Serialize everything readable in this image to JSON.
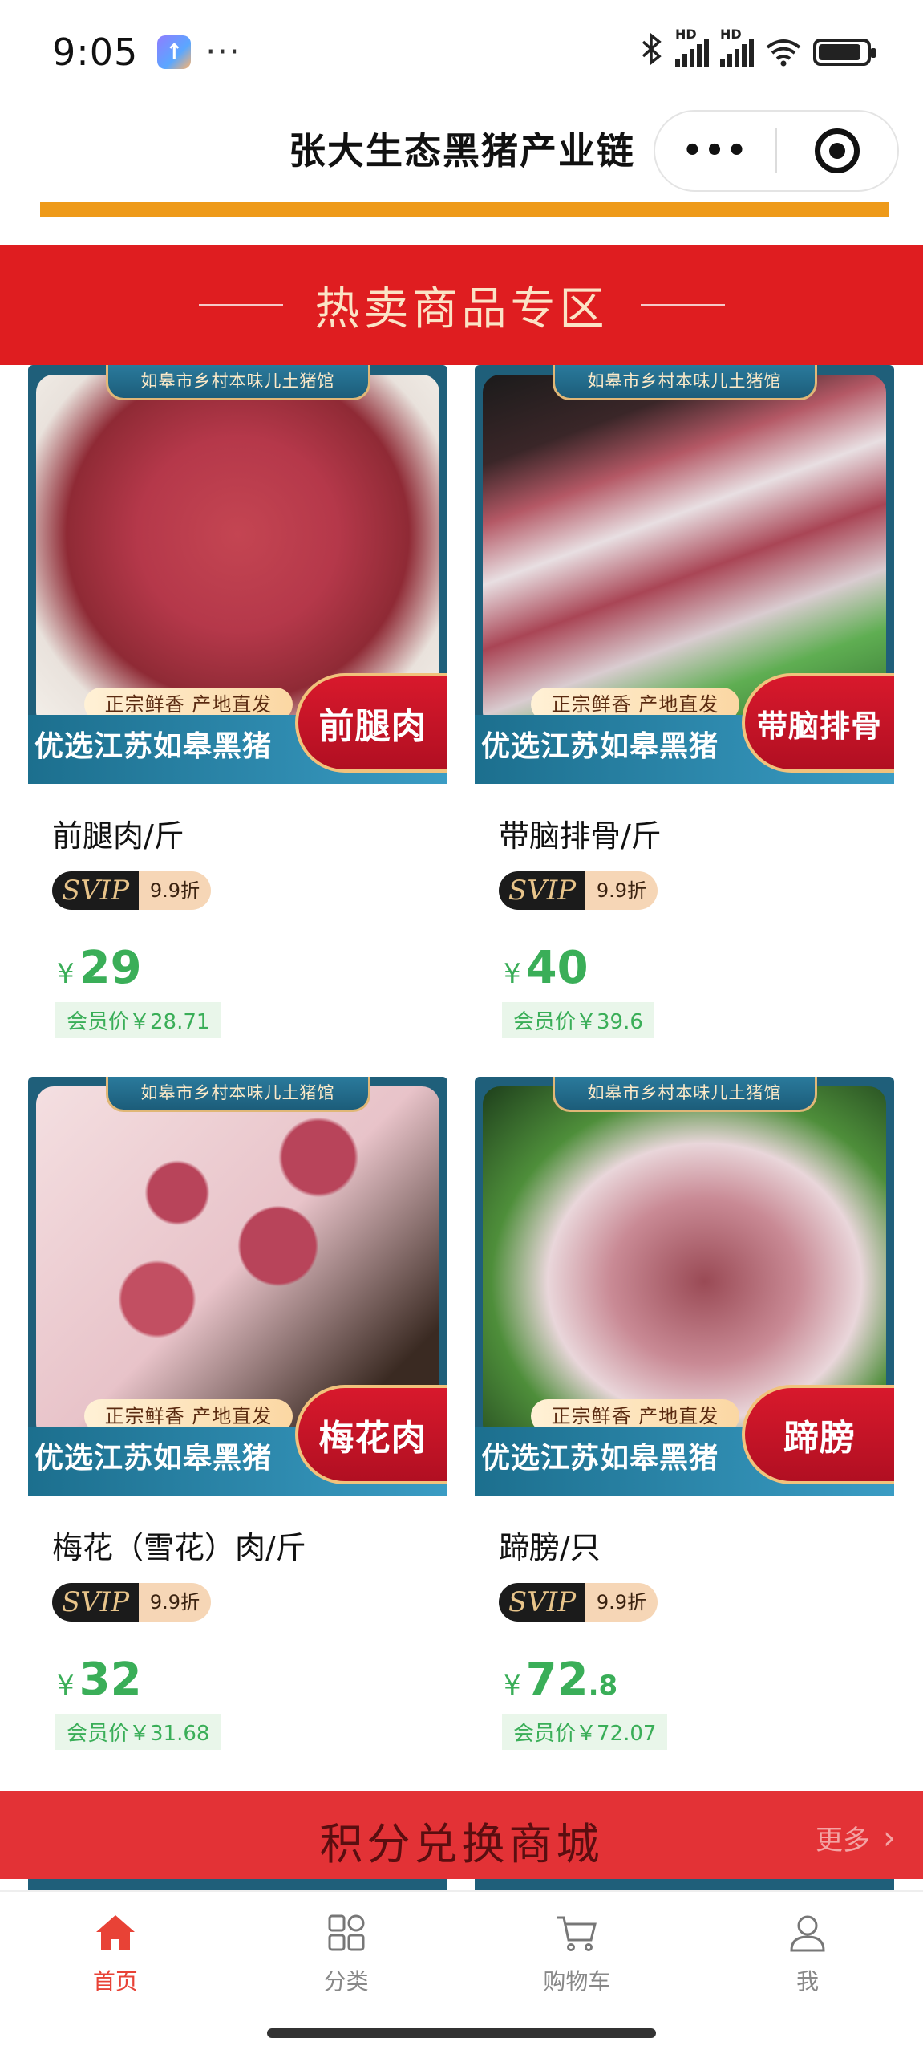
{
  "status_bar": {
    "time": "9:05",
    "app_icon": "app-badge-icon",
    "more_dots": "···",
    "signal_label_1": "HD",
    "signal_label_2": "HD",
    "wifi_label": "6",
    "battery_level": 0.9
  },
  "title_bar": {
    "title": "张大生态黑猪产业链",
    "capsule_more": "•••"
  },
  "hot_section": {
    "title": "热卖商品专区"
  },
  "banner_text": {
    "shop_name": "如皋市乡村本味儿土猪馆",
    "slogan": "正宗鲜香 产地直发",
    "headline": "优选江苏如皋黑猪"
  },
  "products": [
    {
      "thumb_label": "前腿肉",
      "name": "前腿肉/斤",
      "svip": "SVIP",
      "discount": "9.9折",
      "currency": "¥",
      "price_int": "29",
      "price_dec": "",
      "member_price": "会员价￥28.71"
    },
    {
      "thumb_label": "带脑排骨",
      "name": "带脑排骨/斤",
      "svip": "SVIP",
      "discount": "9.9折",
      "currency": "¥",
      "price_int": "40",
      "price_dec": "",
      "member_price": "会员价￥39.6"
    },
    {
      "thumb_label": "梅花肉",
      "name": "梅花（雪花）肉/斤",
      "svip": "SVIP",
      "discount": "9.9折",
      "currency": "¥",
      "price_int": "32",
      "price_dec": "",
      "member_price": "会员价￥31.68"
    },
    {
      "thumb_label": "蹄膀",
      "name": "蹄膀/只",
      "svip": "SVIP",
      "discount": "9.9折",
      "currency": "¥",
      "price_int": "72",
      "price_dec": ".8",
      "member_price": "会员价￥72.07"
    }
  ],
  "points_section": {
    "title": "积分兑换商城",
    "more": "更多",
    "chevron": "›"
  },
  "tab_bar": {
    "tabs": [
      {
        "label": "首页",
        "icon": "home-icon",
        "active": true
      },
      {
        "label": "分类",
        "icon": "category-icon",
        "active": false
      },
      {
        "label": "购物车",
        "icon": "cart-icon",
        "active": false
      },
      {
        "label": "我",
        "icon": "profile-icon",
        "active": false
      }
    ]
  },
  "colors": {
    "primary_red": "#df1d20",
    "accent_orange": "#ee9a1a",
    "price_green": "#3aae58",
    "tab_active": "#e84236"
  }
}
